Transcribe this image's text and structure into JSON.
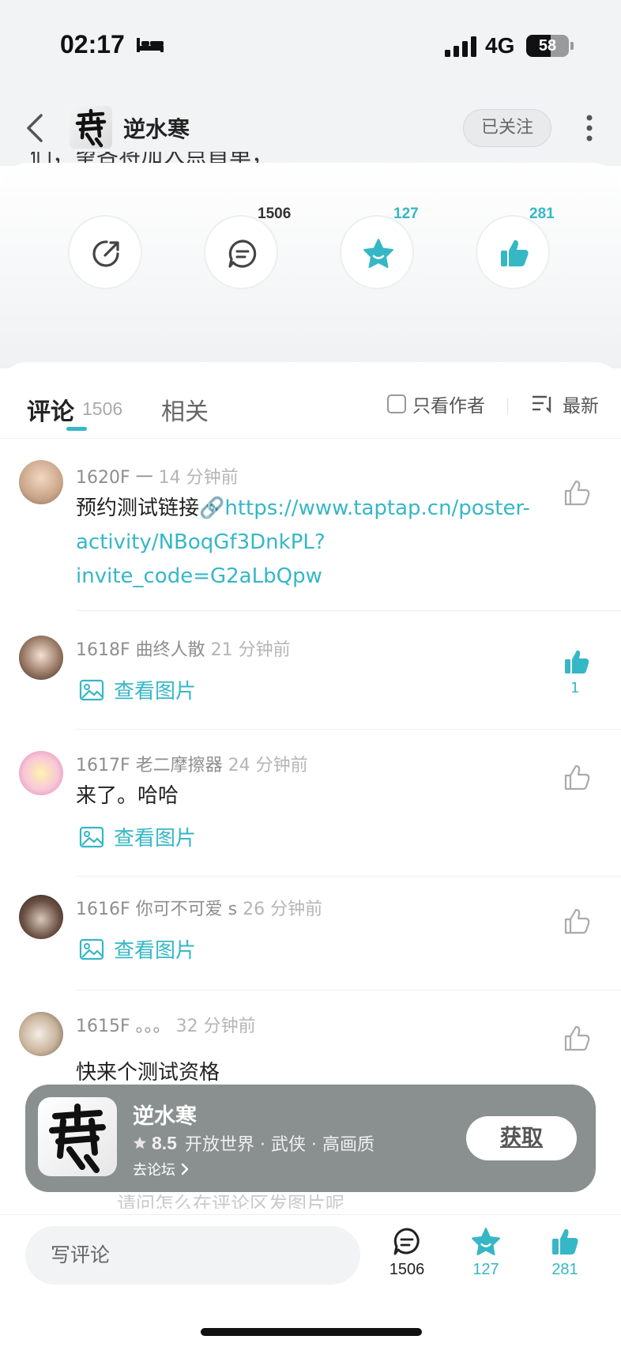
{
  "status_bar": {
    "time": "02:17",
    "network": "4G",
    "battery": "58",
    "battery_level": 0.58
  },
  "header": {
    "title": "逆水寒",
    "follow_label": "已关注"
  },
  "post": {
    "truncated_text": "们，望各将加入点首单，"
  },
  "actions": {
    "comments": "1506",
    "favorites": "127",
    "likes": "281"
  },
  "tabs": {
    "comments_label": "评论",
    "comments_count": "1506",
    "related_label": "相关"
  },
  "filters": {
    "only_author": "只看作者",
    "sort": "最新"
  },
  "comments": [
    {
      "floor": "1620F",
      "user": "一",
      "time": "14 分钟前",
      "text": "预约测试链接🔗",
      "link": "https://www.taptap.cn/poster-activity/NBoqGf3DnkPL?invite_code=G2aLbQpw",
      "likes": ""
    },
    {
      "floor": "1618F",
      "user": "曲终人散",
      "time": "21 分钟前",
      "view_image": "查看图片",
      "likes": "1"
    },
    {
      "floor": "1617F",
      "user": "老二摩擦器",
      "time": "24 分钟前",
      "text": "来了。哈哈",
      "view_image": "查看图片",
      "likes": ""
    },
    {
      "floor": "1616F",
      "user": "你可不可爱 s",
      "time": "26 分钟前",
      "view_image": "查看图片",
      "likes": ""
    },
    {
      "floor": "1615F",
      "user": "。。。",
      "time": "32 分钟前",
      "text": "快来个测试资格",
      "likes": ""
    }
  ],
  "banner": {
    "title": "逆水寒",
    "rating": "8.5",
    "tags": "开放世界 · 武侠 · 高画质",
    "forum_link": "去论坛",
    "get_label": "获取"
  },
  "ghost_text": "请问怎么在评论区发图片呢",
  "bottom_bar": {
    "input_placeholder": "写评论",
    "comments": "1506",
    "favorites": "127",
    "likes": "281"
  },
  "colors": {
    "accent": "#36b7c6",
    "muted": "#8e8e8e"
  }
}
